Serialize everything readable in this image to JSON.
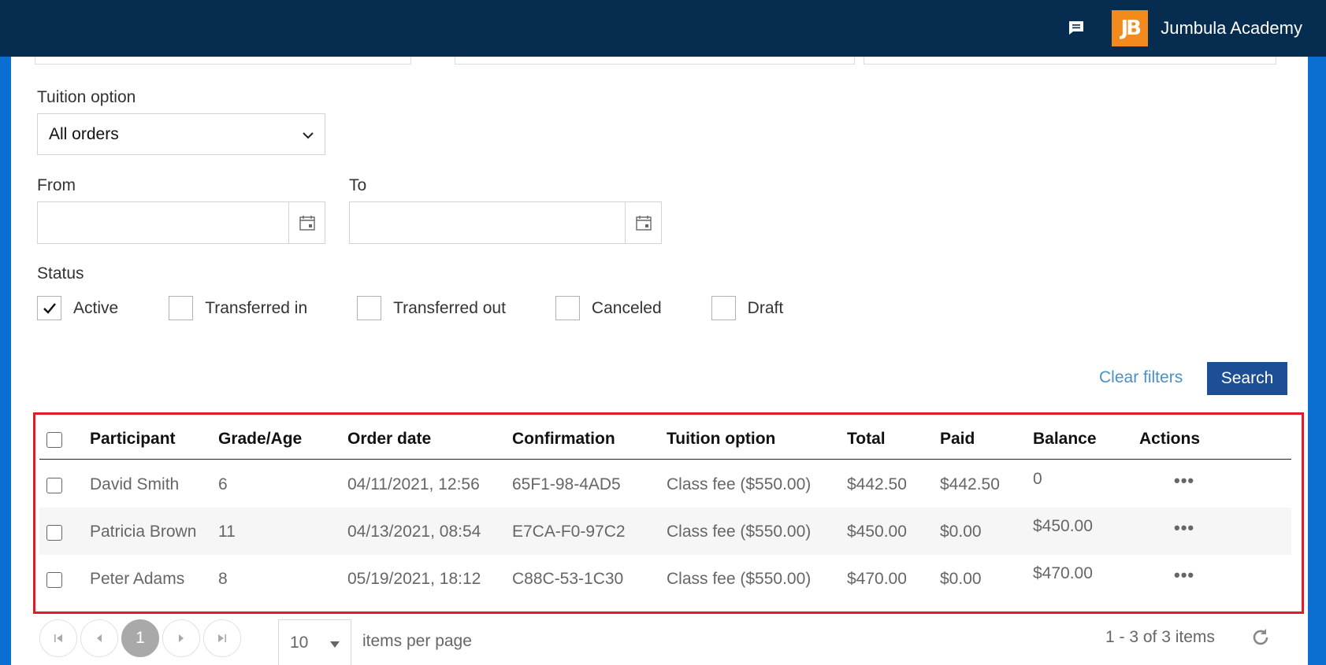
{
  "header": {
    "org_name": "Jumbula Academy",
    "logo_text": "JB"
  },
  "filters": {
    "tuition_label": "Tuition option",
    "tuition_value": "All orders",
    "from_label": "From",
    "to_label": "To",
    "from_value": "",
    "to_value": "",
    "status_label": "Status",
    "statuses": [
      {
        "label": "Active",
        "checked": true
      },
      {
        "label": "Transferred in",
        "checked": false
      },
      {
        "label": "Transferred out",
        "checked": false
      },
      {
        "label": "Canceled",
        "checked": false
      },
      {
        "label": "Draft",
        "checked": false
      }
    ],
    "clear_label": "Clear filters",
    "search_label": "Search"
  },
  "table": {
    "headers": [
      "Participant",
      "Grade/Age",
      "Order date",
      "Confirmation",
      "Tuition option",
      "Total",
      "Paid",
      "Balance",
      "Actions"
    ],
    "rows": [
      {
        "participant": "David Smith",
        "grade": "6",
        "order_date": "04/11/2021, 12:56",
        "confirmation": "65F1-98-4AD5",
        "tuition": "Class fee ($550.00)",
        "total": "$442.50",
        "paid": "$442.50",
        "balance": "0",
        "actions": "•••"
      },
      {
        "participant": "Patricia Brown",
        "grade": "11",
        "order_date": "04/13/2021, 08:54",
        "confirmation": "E7CA-F0-97C2",
        "tuition": "Class fee ($550.00)",
        "total": "$450.00",
        "paid": "$0.00",
        "balance": "$450.00",
        "actions": "•••"
      },
      {
        "participant": "Peter Adams",
        "grade": "8",
        "order_date": "05/19/2021, 18:12",
        "confirmation": "C88C-53-1C30",
        "tuition": "Class fee ($550.00)",
        "total": "$470.00",
        "paid": "$0.00",
        "balance": "$470.00",
        "actions": "•••"
      }
    ]
  },
  "pager": {
    "current_page": "1",
    "page_size": "10",
    "per_page_label": "items per page",
    "summary": "1 - 3 of 3 items"
  },
  "colors": {
    "topbar": "#062c4f",
    "side_background": "#0b6fd1",
    "primary_button": "#1c4f95",
    "link": "#3a86c8",
    "balance_due": "#d0211c",
    "highlight_border": "#e11b28",
    "logo": "#f28a1e"
  },
  "icons": [
    "chat-icon",
    "calendar-icon",
    "chevron-down-icon",
    "checkmark-icon",
    "first-page-icon",
    "prev-page-icon",
    "next-page-icon",
    "last-page-icon",
    "refresh-icon"
  ]
}
